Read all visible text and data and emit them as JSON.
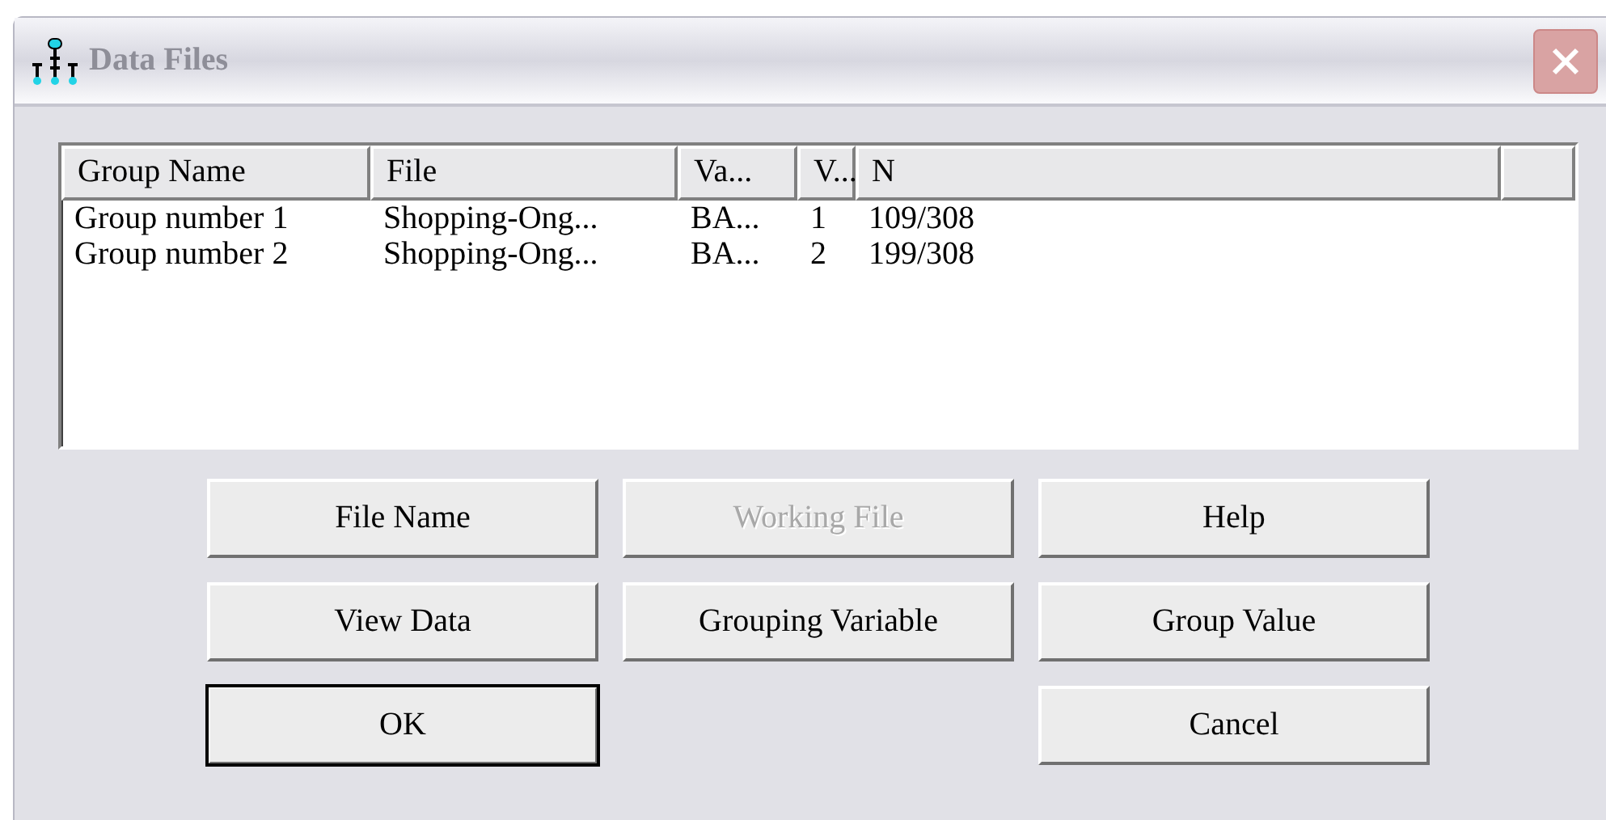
{
  "window": {
    "title": "Data Files"
  },
  "table": {
    "columns": [
      "Group Name",
      "File",
      "Va...",
      "V...",
      "N"
    ],
    "rows": [
      [
        "Group number 1",
        "Shopping-Ong...",
        "BA...",
        "1",
        "109/308"
      ],
      [
        "Group number 2",
        "Shopping-Ong...",
        "BA...",
        "2",
        "199/308"
      ]
    ]
  },
  "buttons": [
    {
      "label": "File Name",
      "disabled": false,
      "default": false
    },
    {
      "label": "Working File",
      "disabled": true,
      "default": false
    },
    {
      "label": "Help",
      "disabled": false,
      "default": false
    },
    {
      "label": "View Data",
      "disabled": false,
      "default": false
    },
    {
      "label": "Grouping Variable",
      "disabled": false,
      "default": false
    },
    {
      "label": "Group Value",
      "disabled": false,
      "default": false
    },
    {
      "label": "OK",
      "disabled": false,
      "default": true
    },
    {
      "label": "Cancel",
      "disabled": false,
      "default": false
    }
  ]
}
